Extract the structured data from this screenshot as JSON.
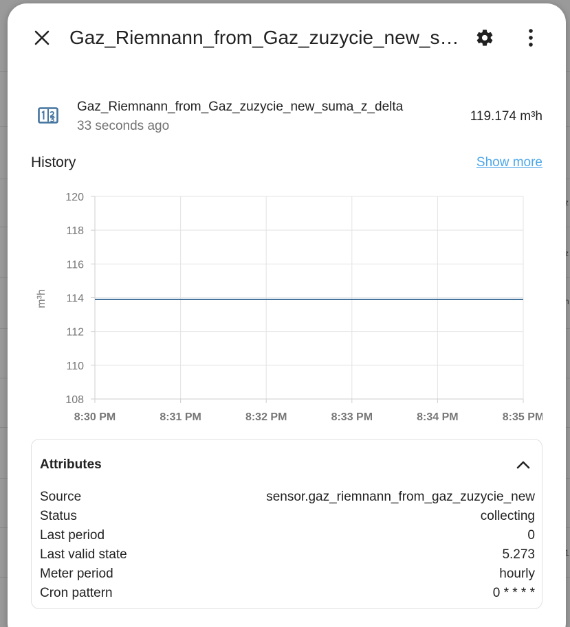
{
  "dialog": {
    "title": "Gaz_Riemnann_from_Gaz_zuzycie_new_suma_z_delta"
  },
  "entity": {
    "name": "Gaz_Riemnann_from_Gaz_zuzycie_new_suma_z_delta",
    "last_changed": "33 seconds ago",
    "state": "119.174 m³h",
    "icon": "counter-icon"
  },
  "history": {
    "title": "History",
    "show_more": "Show more"
  },
  "chart_data": {
    "type": "line",
    "x": [
      "8:30 PM",
      "8:31 PM",
      "8:32 PM",
      "8:33 PM",
      "8:34 PM",
      "8:35 PM"
    ],
    "series": [
      {
        "values": [
          113.9,
          113.9,
          113.9,
          113.9,
          113.9,
          113.9
        ]
      }
    ],
    "ylabel": "m³h",
    "ylim": [
      108,
      120
    ],
    "yticks": [
      "120",
      "118",
      "116",
      "114",
      "112",
      "110",
      "108"
    ],
    "grid": true,
    "line_color": "#44739e"
  },
  "attributes": {
    "title": "Attributes",
    "rows": [
      {
        "label": "Source",
        "value": "sensor.gaz_riemnann_from_gaz_zuzycie_new"
      },
      {
        "label": "Status",
        "value": "collecting"
      },
      {
        "label": "Last period",
        "value": "0"
      },
      {
        "label": "Last valid state",
        "value": "5.273"
      },
      {
        "label": "Meter period",
        "value": "hourly"
      },
      {
        "label": "Cron pattern",
        "value": "0 * * * *"
      }
    ]
  },
  "background": {
    "fragments": [
      "z",
      "z",
      "n",
      "1"
    ]
  }
}
